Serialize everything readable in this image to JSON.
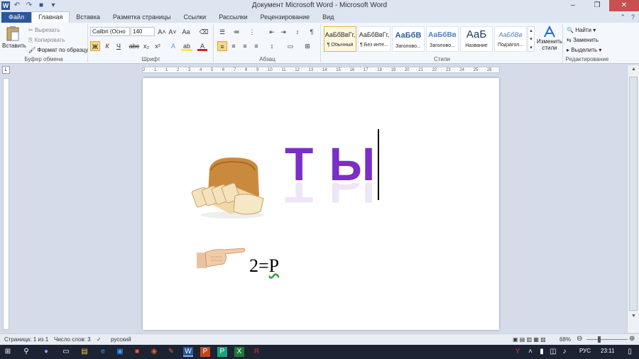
{
  "window": {
    "title": "Документ Microsoft Word - Microsoft Word",
    "minimize": "–",
    "restore": "❐",
    "close": "✕"
  },
  "quick_access": {
    "logo": "W",
    "undo": "↶",
    "redo": "↷",
    "save": "💾",
    "customize": "▾"
  },
  "tabs": [
    "Файл",
    "Главная",
    "Вставка",
    "Разметка страницы",
    "Ссылки",
    "Рассылки",
    "Рецензирование",
    "Вид"
  ],
  "tab_help": {
    "collapse": "⌃",
    "help": "?"
  },
  "clipboard": {
    "paste": "Вставить",
    "cut": "Вырезать",
    "copy": "Копировать",
    "format_painter": "Формат по образцу",
    "group": "Буфер обмена"
  },
  "font": {
    "name": "Calibri (Осно",
    "size": "140",
    "grow": "A˄",
    "shrink": "A˅",
    "case": "Aa",
    "clear": "⌫",
    "bold": "Ж",
    "italic": "К",
    "underline": "Ч",
    "strike": "abc",
    "subscript": "x₂",
    "superscript": "x²",
    "effects": "A",
    "highlight": "ab",
    "color": "A",
    "group": "Шрифт"
  },
  "paragraph": {
    "group": "Абзац",
    "bullets": "☰",
    "numbering": "≔",
    "multilevel": "⋮",
    "dec_indent": "⇤",
    "inc_indent": "⇥",
    "sort": "↕",
    "marks": "¶",
    "align_left": "≡",
    "center": "≡",
    "right": "≡",
    "justify": "≡",
    "spacing": "↕",
    "shading": "▭",
    "borders": "⊞"
  },
  "styles": {
    "group": "Стили",
    "items": [
      {
        "preview": "АаБбВвГг,",
        "name": "¶ Обычный"
      },
      {
        "preview": "АаБбВвГг,",
        "name": "¶ Без инте..."
      },
      {
        "preview": "АаБбВ",
        "name": "Заголово..."
      },
      {
        "preview": "АаБбВв",
        "name": "Заголово..."
      },
      {
        "preview": "АаБ",
        "name": "Название"
      },
      {
        "preview": "АаБбВв",
        "name": "Подзагол..."
      }
    ],
    "change": "Изменить стили"
  },
  "editing": {
    "group": "Редактирование",
    "find": "Найти",
    "replace": "Заменить",
    "select": "Выделить"
  },
  "ruler": {
    "marks": "2 · · · 1 · · · 1 · · · 2 · · · 3 · · · 4 · · · 5 · · · 6 · · · 7 · · · 8 · · · 9 · · · 10 · · · 11 · · · 12 · · · 13 · · · 14 · · · 15 · · · 16 · · · 17 · · · 18 · · · 19 · · · 20 · · · 21 · · · 22 · · · 23 · · · 24 · · · 25 · · · 26 · · · 27"
  },
  "document": {
    "word_text": "Т Ы",
    "formula_left": "2=",
    "formula_right": "Р"
  },
  "status": {
    "page": "Страница: 1 из 1",
    "words": "Число слов: 3",
    "language": "русский",
    "zoom": "68%"
  },
  "taskbar": {
    "language": "РУС",
    "time": "23:11"
  }
}
